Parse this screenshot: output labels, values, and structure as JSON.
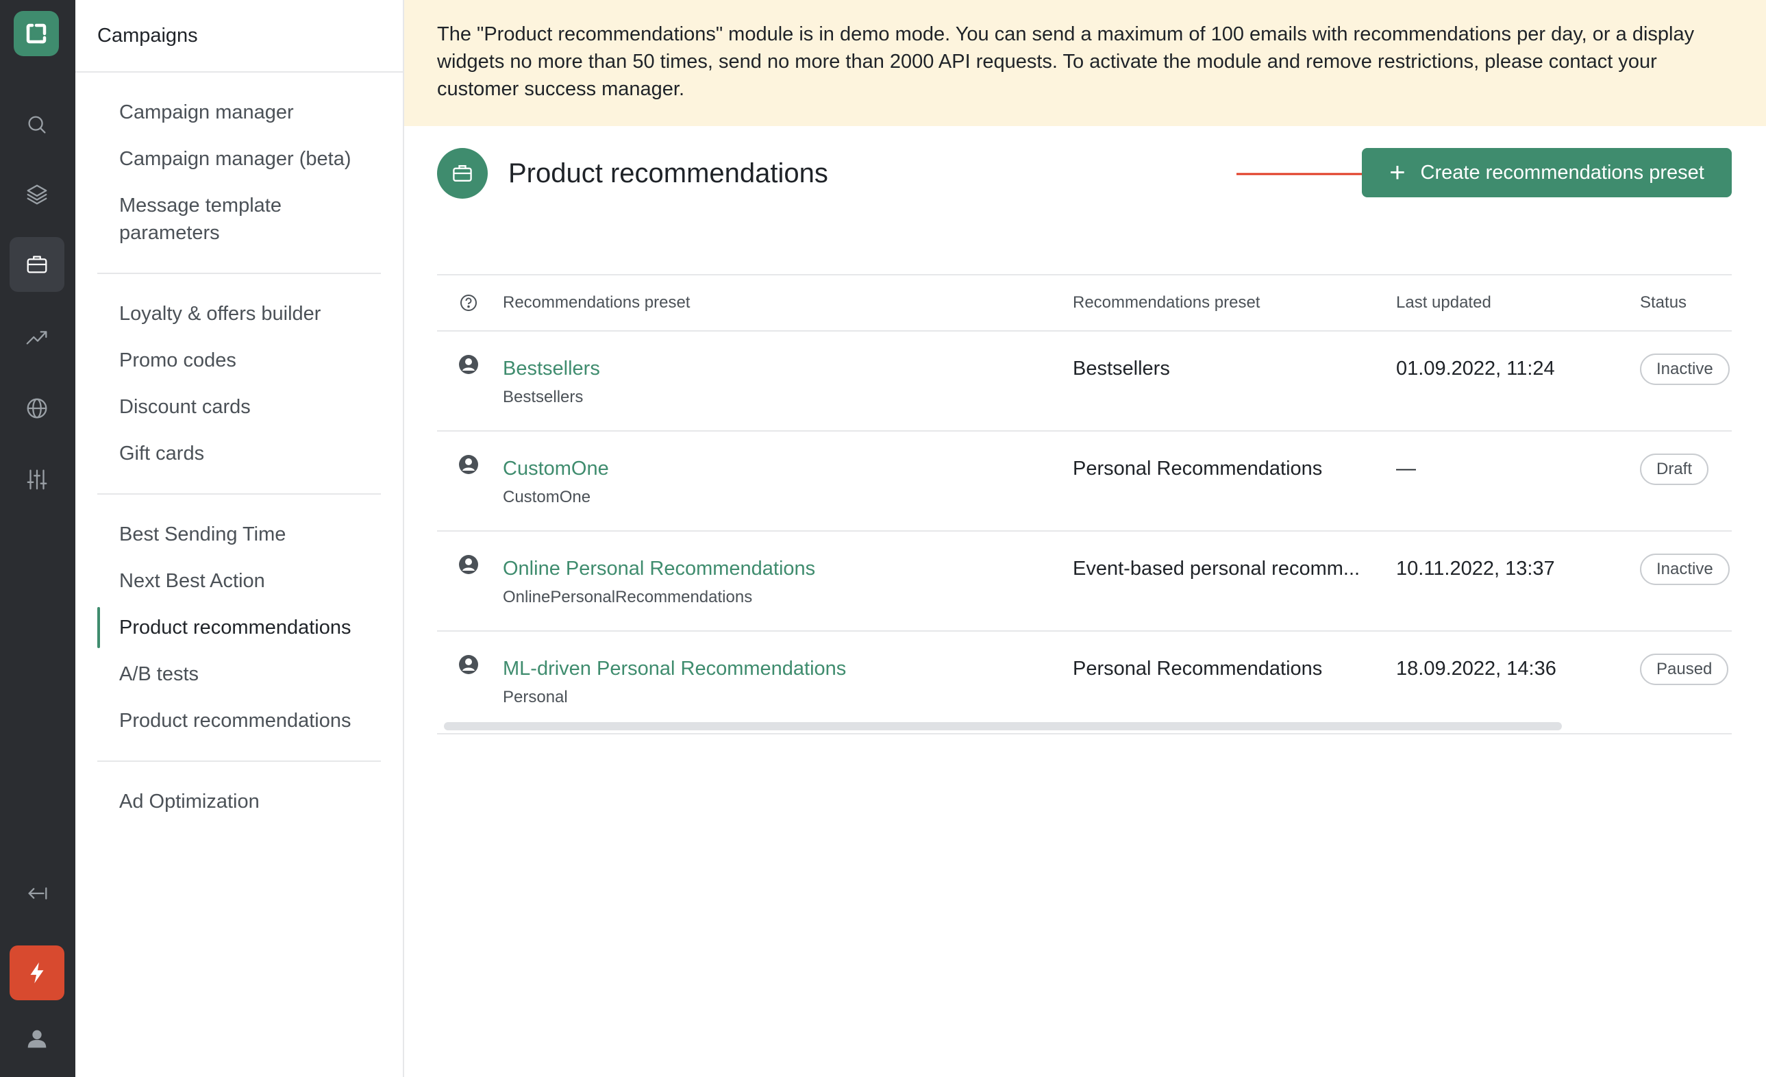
{
  "rail": {
    "items": [
      {
        "icon": "logo-icon"
      },
      {
        "icon": "search-icon"
      },
      {
        "icon": "layers-icon"
      },
      {
        "icon": "briefcase-icon",
        "active": true
      },
      {
        "icon": "trend-icon"
      },
      {
        "icon": "globe-icon"
      },
      {
        "icon": "sliders-icon"
      },
      {
        "icon": "collapse-icon"
      },
      {
        "icon": "bolt-icon"
      },
      {
        "icon": "user-icon"
      }
    ]
  },
  "sidebar": {
    "title": "Campaigns",
    "groups": [
      [
        "Campaign manager",
        "Campaign manager (beta)",
        "Message template parameters"
      ],
      [
        "Loyalty & offers builder",
        "Promo codes",
        "Discount cards",
        "Gift cards"
      ],
      [
        "Best Sending Time",
        "Next Best Action",
        "Product recommendations",
        "A/B tests",
        "Product recommendations"
      ],
      [
        "Ad Optimization"
      ]
    ],
    "active": "Product recommendations"
  },
  "banner": {
    "text": "The \"Product recommendations\" module is in demo mode. You can send a maximum of 100 emails with recommendations per day, or a display widgets no more than 50 times, send no more than 2000 API requests. To activate the module and remove restrictions, please contact your customer success manager."
  },
  "header": {
    "title": "Product recommendations",
    "create_label": "Create recommendations preset",
    "accent": "#3f8c6e",
    "arrow_color": "#e03b24"
  },
  "table": {
    "columns": {
      "name": "Recommendations preset",
      "type": "Recommendations preset",
      "date": "Last updated",
      "status": "Status"
    },
    "rows": [
      {
        "name": "Bestsellers",
        "sub": "Bestsellers",
        "type": "Bestsellers",
        "date": "01.09.2022, 11:24",
        "status": "Inactive"
      },
      {
        "name": "CustomOne",
        "sub": "CustomOne",
        "type": "Personal Recommendations",
        "date": "—",
        "status": "Draft"
      },
      {
        "name": "Online Personal Recommendations",
        "sub": "OnlinePersonalRecommendations",
        "type": "Event-based personal recomm...",
        "date": "10.11.2022, 13:37",
        "status": "Inactive"
      },
      {
        "name": "ML-driven Personal Recommendations",
        "sub": "Personal",
        "type": "Personal Recommendations",
        "date": "18.09.2022, 14:36",
        "status": "Paused"
      }
    ]
  }
}
